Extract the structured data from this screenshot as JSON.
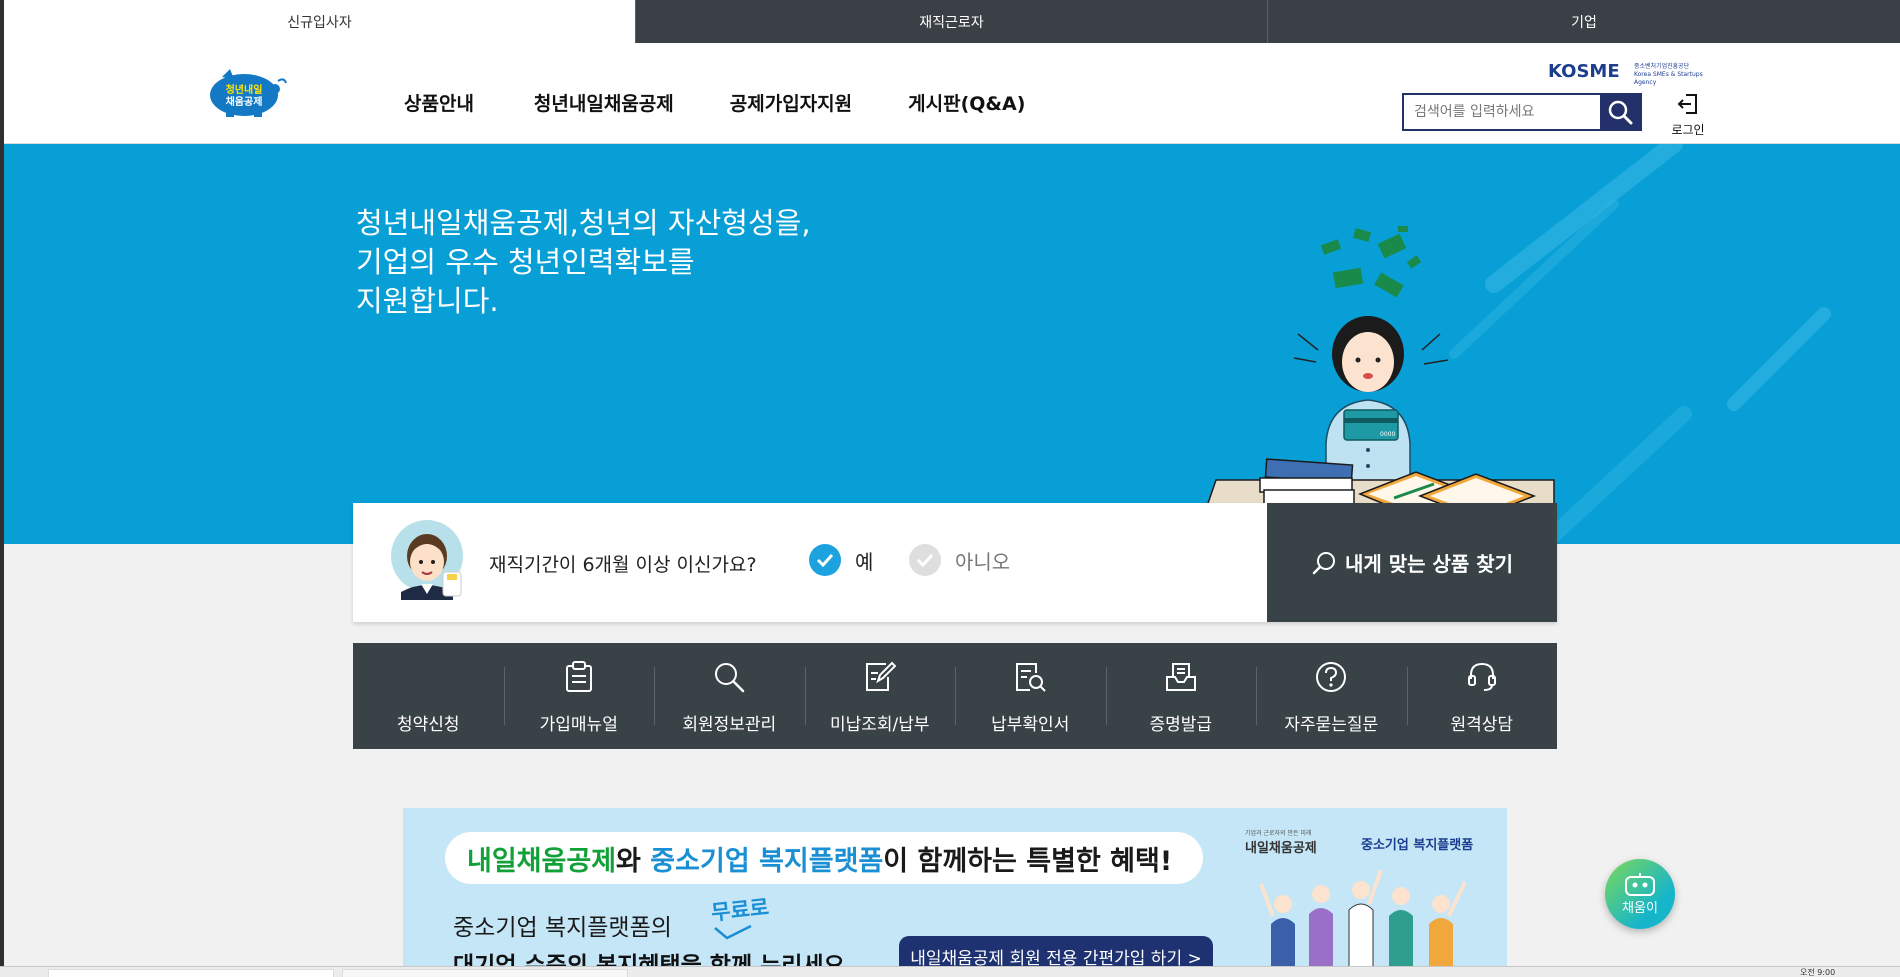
{
  "audience_tabs": [
    {
      "label": "신규입사자",
      "active": true
    },
    {
      "label": "재직근로자",
      "active": false
    },
    {
      "label": "기업",
      "active": false
    }
  ],
  "header": {
    "logo_line1": "청년내일",
    "logo_line2": "채움공제",
    "nav": [
      "상품안내",
      "청년내일채움공제",
      "공제가입자지원",
      "게시판(Q&A)"
    ],
    "org_logo": "KOSME",
    "org_sub1": "중소벤처기업진흥공단",
    "org_sub2": "Korea SMEs & Startups Agency",
    "search_placeholder": "검색어를 입력하세요",
    "login_label": "로그인"
  },
  "hero": {
    "lines": [
      "청년내일채움공제,청년의 자산형성을,",
      "기업의 우수 청년인력확보를",
      "지원합니다."
    ],
    "card_text": "0000"
  },
  "question": {
    "text": "재직기간이 6개월 이상 이신가요?",
    "yes_label": "예",
    "no_label": "아니오",
    "selected": "예",
    "find_button": "내게 맞는 상품 찾기"
  },
  "quick_menu": [
    {
      "label": "청약신청",
      "icon": "none"
    },
    {
      "label": "가입매뉴얼",
      "icon": "clipboard-icon"
    },
    {
      "label": "회원정보관리",
      "icon": "search-icon"
    },
    {
      "label": "미납조회/납부",
      "icon": "edit-document-icon"
    },
    {
      "label": "납부확인서",
      "icon": "document-search-icon"
    },
    {
      "label": "증명발급",
      "icon": "inbox-document-icon"
    },
    {
      "label": "자주묻는질문",
      "icon": "question-circle-icon"
    },
    {
      "label": "원격상담",
      "icon": "headset-icon"
    }
  ],
  "banner": {
    "title_part1": "내일채움공제",
    "title_part2": "와 ",
    "title_part3": "중소기업 복지플랫폼",
    "title_part4": "이 함께하는 특별한 혜택!",
    "subtitle1": "중소기업 복지플랫폼의",
    "free_label": "무료로",
    "subtitle2": "대기업 수준의 복지혜택을 함께 누리세요",
    "join_button": "내일채움공제 회원 전용 간편가입 하기 >",
    "brand1_tag": "기업과 근로자의 만든 미래",
    "brand1": "내일채움공제",
    "brand2": "중소기업 복지플랫폼"
  },
  "chatbot": {
    "label": "채움이"
  },
  "taskbar": {
    "clock": "오전 9:00"
  },
  "colors": {
    "hero_bg": "#079fd6",
    "dark_panel": "#394247",
    "navy": "#23306a",
    "check_blue": "#1da2e0"
  }
}
